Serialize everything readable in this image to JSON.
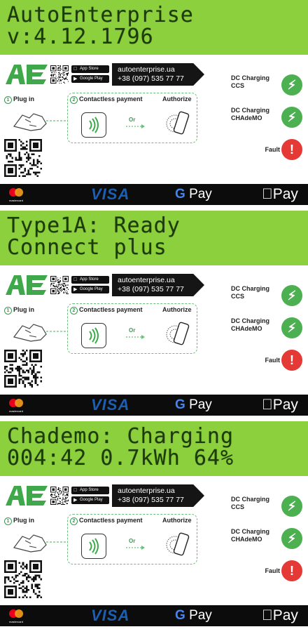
{
  "colors": {
    "lcd_background": "#8cd13d",
    "lcd_text": "#1d3b0c",
    "ok_status": "#4caf50",
    "fault_status": "#e53935",
    "brand_green": "#3a9a52",
    "strip_background": "#0c0c0c"
  },
  "panels": [
    {
      "lcd_line_1": "AutoEnterprise",
      "lcd_line_2": "v:4.12.1796"
    },
    {
      "lcd_line_1": "Type1A: Ready",
      "lcd_line_2": "Connect plus"
    },
    {
      "lcd_line_1": "Chademo: Charging",
      "lcd_line_2": "004:42 0.7kWh 64%"
    }
  ],
  "sticker": {
    "website": "autoenterprise.ua",
    "phone": "+38 (097) 535 77 77",
    "app_store": "App Store",
    "google_play": "Google Play",
    "step1_number": "1",
    "step1": "Plug in",
    "step2_number": "2",
    "step2": "Contactless payment",
    "authorize": "Authorize",
    "or": "Or",
    "status_ccs_line1": "DC Charging",
    "status_ccs_line2": "CCS",
    "status_ccs_icon": "lightning-icon",
    "status_chademo_line1": "DC Charging",
    "status_chademo_line2": "CHAdeMO",
    "status_chademo_icon": "lightning-icon",
    "status_fault": "Fault",
    "status_fault_icon": "exclamation-icon",
    "nfc_icon": "contactless-icon",
    "pay_methods": {
      "mastercard": "mastercard",
      "visa": "VISA",
      "gpay": "Pay",
      "applepay": "Pay"
    }
  }
}
